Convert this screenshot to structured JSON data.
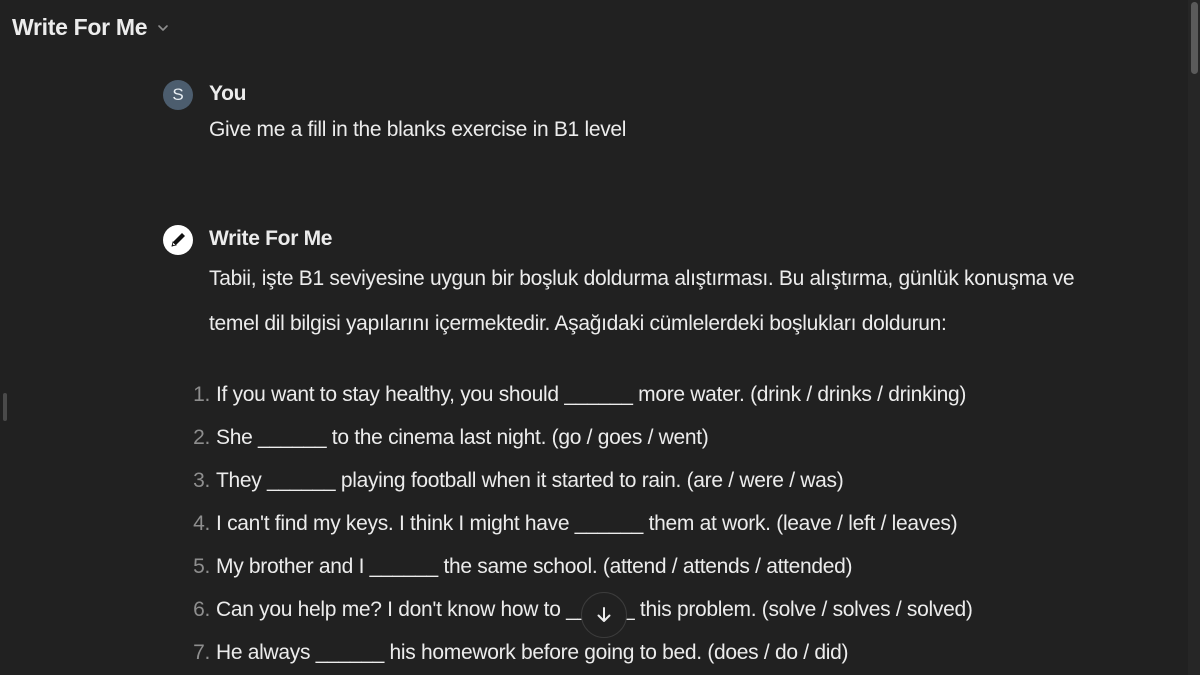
{
  "header": {
    "title": "Write For Me",
    "chevron_icon": "chevron-down-icon"
  },
  "messages": {
    "user": {
      "avatar_letter": "S",
      "sender": "You",
      "text": "Give me a fill in the blanks exercise in B1 level"
    },
    "assistant": {
      "avatar_icon": "pen-icon",
      "sender": "Write For Me",
      "intro_line1": "Tabii, işte B1 seviyesine uygun bir boşluk doldurma alıştırması. Bu alıştırma, günlük konuşma ve",
      "intro_line2": "temel dil bilgisi yapılarını içermektedir. Aşağıdaki cümlelerdeki boşlukları doldurun:",
      "items": [
        {
          "num": "1.",
          "text": "If you want to stay healthy, you should ______ more water. (drink / drinks / drinking)"
        },
        {
          "num": "2.",
          "text": "She ______ to the cinema last night. (go / goes / went)"
        },
        {
          "num": "3.",
          "text": "They ______ playing football when it started to rain. (are / were / was)"
        },
        {
          "num": "4.",
          "text": "I can't find my keys. I think I might have ______ them at work. (leave / left / leaves)"
        },
        {
          "num": "5.",
          "text": "My brother and I ______ the same school. (attend / attends / attended)"
        },
        {
          "num": "6.",
          "text": "Can you help me? I don't know how to ______ this problem. (solve / solves / solved)"
        },
        {
          "num": "7.",
          "text": "He always ______ his homework before going to bed. (does / do / did)"
        }
      ]
    }
  },
  "scroll_down_icon": "arrow-down-icon"
}
